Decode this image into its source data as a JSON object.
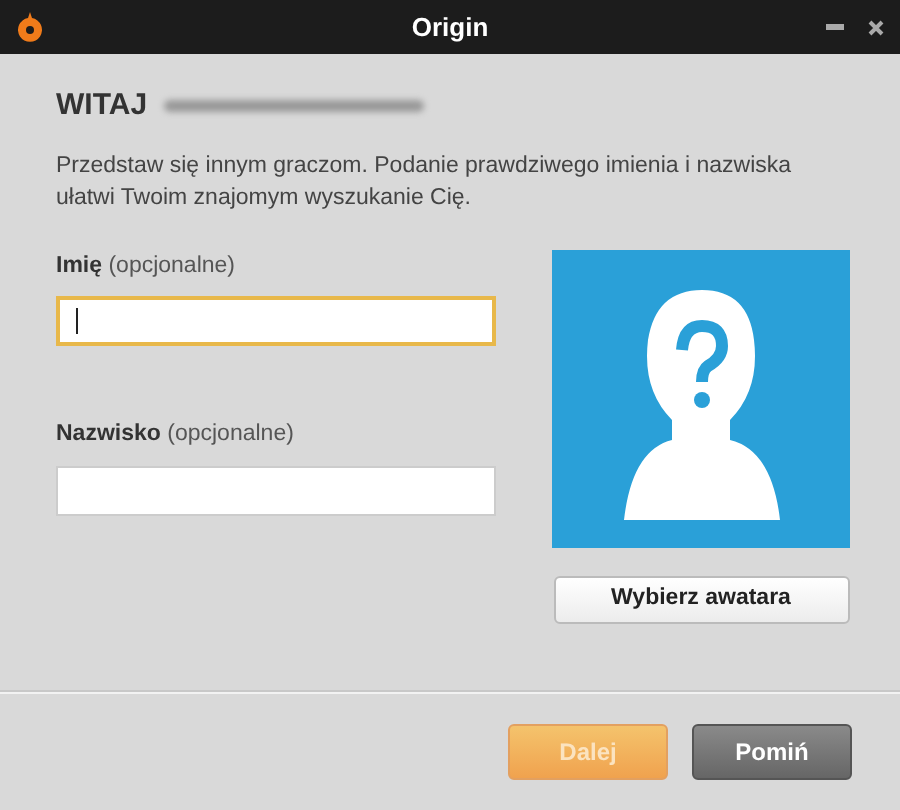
{
  "window": {
    "title": "Origin"
  },
  "heading": "WITAJ",
  "intro": "Przedstaw się innym graczom. Podanie prawdziwego imienia i nazwiska ułatwi Twoim znajomym wyszukanie Cię.",
  "fields": [
    {
      "label": "Imię",
      "hint": "(opcjonalne)",
      "focused": true
    },
    {
      "label": "Nazwisko",
      "hint": "(opcjonalne)",
      "focused": false
    }
  ],
  "avatar_button": "Wybierz awatara",
  "buttons": [
    {
      "label": "Dalej",
      "kind": "primary",
      "disabled": true
    },
    {
      "label": "Pomiń",
      "kind": "secondary",
      "disabled": false
    }
  ]
}
